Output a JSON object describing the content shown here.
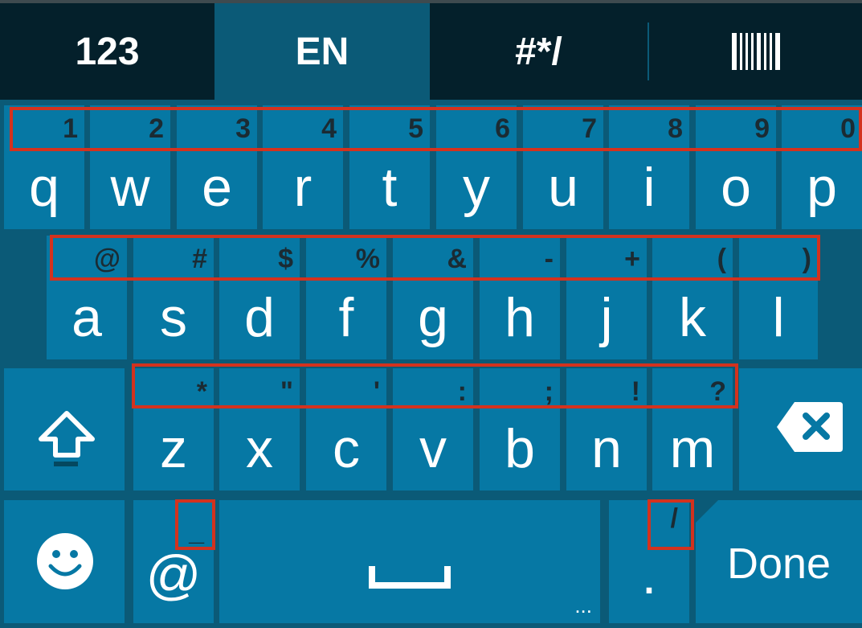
{
  "tabs": {
    "numbers": "123",
    "language": "EN",
    "symbols": "#*/",
    "barcode_icon": "barcode-icon"
  },
  "rows": {
    "row1": [
      {
        "hint": "1",
        "label": "q"
      },
      {
        "hint": "2",
        "label": "w"
      },
      {
        "hint": "3",
        "label": "e"
      },
      {
        "hint": "4",
        "label": "r"
      },
      {
        "hint": "5",
        "label": "t"
      },
      {
        "hint": "6",
        "label": "y"
      },
      {
        "hint": "7",
        "label": "u"
      },
      {
        "hint": "8",
        "label": "i"
      },
      {
        "hint": "9",
        "label": "o"
      },
      {
        "hint": "0",
        "label": "p"
      }
    ],
    "row2": [
      {
        "hint": "@",
        "label": "a"
      },
      {
        "hint": "#",
        "label": "s"
      },
      {
        "hint": "$",
        "label": "d"
      },
      {
        "hint": "%",
        "label": "f"
      },
      {
        "hint": "&",
        "label": "g"
      },
      {
        "hint": "-",
        "label": "h"
      },
      {
        "hint": "+",
        "label": "j"
      },
      {
        "hint": "(",
        "label": "k"
      },
      {
        "hint": ")",
        "label": "l"
      }
    ],
    "row3": [
      {
        "hint": "*",
        "label": "z"
      },
      {
        "hint": "\"",
        "label": "x"
      },
      {
        "hint": "'",
        "label": "c"
      },
      {
        "hint": ":",
        "label": "v"
      },
      {
        "hint": ";",
        "label": "b"
      },
      {
        "hint": "!",
        "label": "n"
      },
      {
        "hint": "?",
        "label": "m"
      }
    ]
  },
  "bottom": {
    "at_hint": "_",
    "at_label": "@",
    "period_hint": "/",
    "period_label": ".",
    "space_more": "...",
    "done_label": "Done"
  },
  "icons": {
    "shift": "shift-icon",
    "backspace": "backspace-icon",
    "emoji": "emoji-icon",
    "space": "space-icon"
  },
  "colors": {
    "key": "#0678a4",
    "keyboard_bg": "#0b5a77",
    "tab_bar": "#04202b",
    "hint_text": "#1b2b33",
    "highlight": "#d3321e"
  }
}
